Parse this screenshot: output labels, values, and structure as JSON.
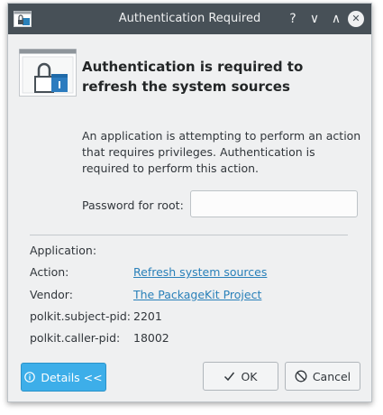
{
  "window": {
    "title": "Authentication Required",
    "controls": {
      "help": "?",
      "minimize": "∨",
      "maximize": "∧",
      "close": "✕"
    }
  },
  "dialog": {
    "heading": "Authentication is required to refresh the system sources",
    "description": "An application is attempting to perform an action that requires privileges. Authentication is required to perform this action.",
    "password_label": "Password for root:",
    "password_value": ""
  },
  "details": [
    {
      "label": "Application:",
      "value": "",
      "link": false
    },
    {
      "label": "Action:",
      "value": "Refresh system sources",
      "link": true
    },
    {
      "label": "Vendor:",
      "value": "The PackageKit Project",
      "link": true
    },
    {
      "label": "polkit.subject-pid:",
      "value": "2201",
      "link": false
    },
    {
      "label": "polkit.caller-pid:",
      "value": "18002",
      "link": false
    }
  ],
  "buttons": {
    "details": "Details <<",
    "ok": "OK",
    "cancel": "Cancel"
  },
  "colors": {
    "titlebar": "#475057",
    "accent": "#3daee9",
    "link": "#2980b9",
    "window_bg": "#eff0f1"
  },
  "icons": {
    "app": "window-lock-icon",
    "header": "window-lock-icon",
    "details": "info-icon",
    "ok": "checkmark-icon",
    "cancel": "cancel-icon"
  }
}
